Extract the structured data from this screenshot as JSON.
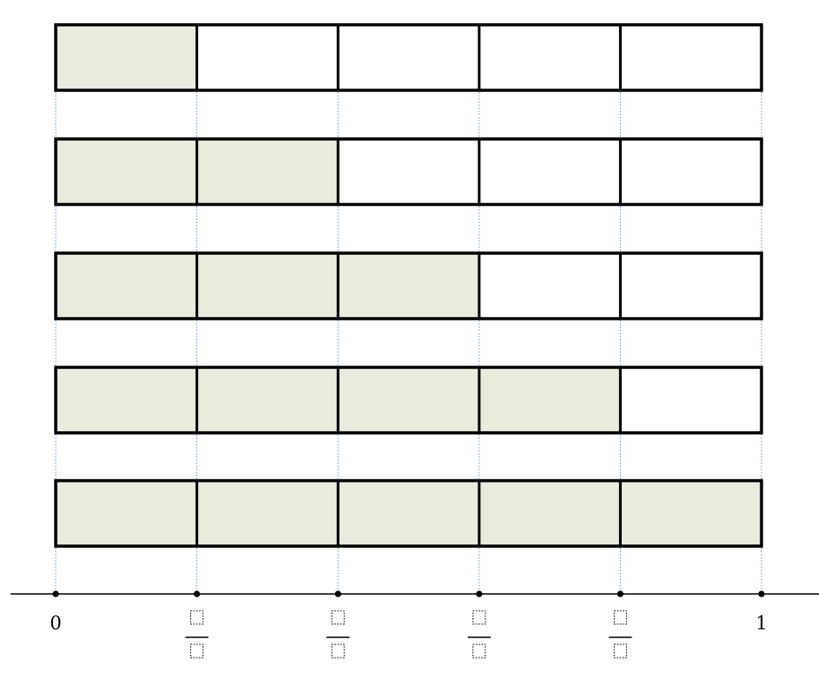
{
  "diagram": {
    "rows": [
      {
        "parts": 5,
        "shaded": 1
      },
      {
        "parts": 5,
        "shaded": 2
      },
      {
        "parts": 5,
        "shaded": 3
      },
      {
        "parts": 5,
        "shaded": 4
      },
      {
        "parts": 5,
        "shaded": 5
      }
    ],
    "number_line": {
      "start_label": "0",
      "end_label": "1",
      "fraction_ticks": 4
    },
    "colors": {
      "shaded": "#e9ecdc",
      "unshaded": "#ffffff",
      "outline": "#000000",
      "guide": "#6f8fc8"
    }
  }
}
